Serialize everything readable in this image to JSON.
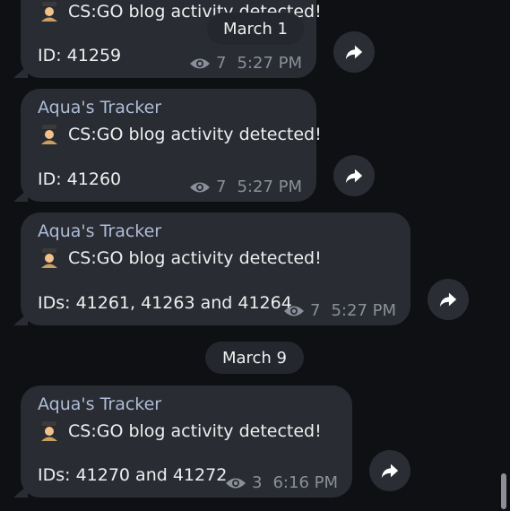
{
  "dates": {
    "first": "March 1",
    "second": "March 9"
  },
  "messages": [
    {
      "sender": "",
      "text": "CS:GO blog activity detected!",
      "ids": "ID: 41259",
      "views": "7",
      "time": "5:27 PM"
    },
    {
      "sender": "Aqua's Tracker",
      "text": "CS:GO blog activity detected!",
      "ids": "ID: 41260",
      "views": "7",
      "time": "5:27 PM"
    },
    {
      "sender": "Aqua's Tracker",
      "text": "CS:GO blog activity detected!",
      "ids": "IDs: 41261, 41263 and 41264",
      "views": "7",
      "time": "5:27 PM"
    },
    {
      "sender": "Aqua's Tracker",
      "text": "CS:GO blog activity detected!",
      "ids": "IDs: 41270 and 41272",
      "views": "3",
      "time": "6:16 PM"
    }
  ],
  "icons": {
    "emoji": "detective-emoji",
    "views": "eye-icon",
    "share": "share-arrow-icon"
  },
  "colors": {
    "bubble": "#292c33",
    "sender": "#aebcd6",
    "meta": "#8a8f9a",
    "background": "#0e1014"
  }
}
